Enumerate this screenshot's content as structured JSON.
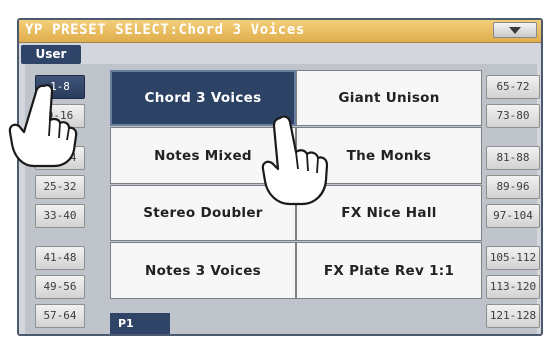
{
  "window": {
    "title": "YP PRESET SELECT:Chord 3 Voices"
  },
  "tabs": [
    {
      "label": "User",
      "selected": true
    }
  ],
  "left_banks": [
    {
      "label": "1-8",
      "selected": true
    },
    {
      "label": "9-16",
      "selected": false
    },
    {
      "label": "17-24",
      "selected": false
    },
    {
      "label": "25-32",
      "selected": false
    },
    {
      "label": "33-40",
      "selected": false
    },
    {
      "label": "41-48",
      "selected": false
    },
    {
      "label": "49-56",
      "selected": false
    },
    {
      "label": "57-64",
      "selected": false
    }
  ],
  "right_banks": [
    {
      "label": "65-72"
    },
    {
      "label": "73-80"
    },
    {
      "label": "81-88"
    },
    {
      "label": "89-96"
    },
    {
      "label": "97-104"
    },
    {
      "label": "105-112"
    },
    {
      "label": "113-120"
    },
    {
      "label": "121-128"
    }
  ],
  "presets": [
    {
      "label": "Chord 3 Voices",
      "selected": true
    },
    {
      "label": "Giant Unison",
      "selected": false
    },
    {
      "label": "Notes Mixed",
      "selected": false
    },
    {
      "label": "The Monks",
      "selected": false
    },
    {
      "label": "Stereo Doubler",
      "selected": false
    },
    {
      "label": "FX Nice Hall",
      "selected": false
    },
    {
      "label": "Notes 3 Voices",
      "selected": false
    },
    {
      "label": "FX Plate Rev 1:1",
      "selected": false
    }
  ],
  "page_tab": {
    "label": "P1"
  },
  "icons": {
    "menu": "triangle-down-icon",
    "touch": "pointing-hand-icon"
  },
  "colors": {
    "title_bar": "#e8b95c",
    "selected": "#2d4366",
    "cell_bg": "#f7f7f7"
  }
}
